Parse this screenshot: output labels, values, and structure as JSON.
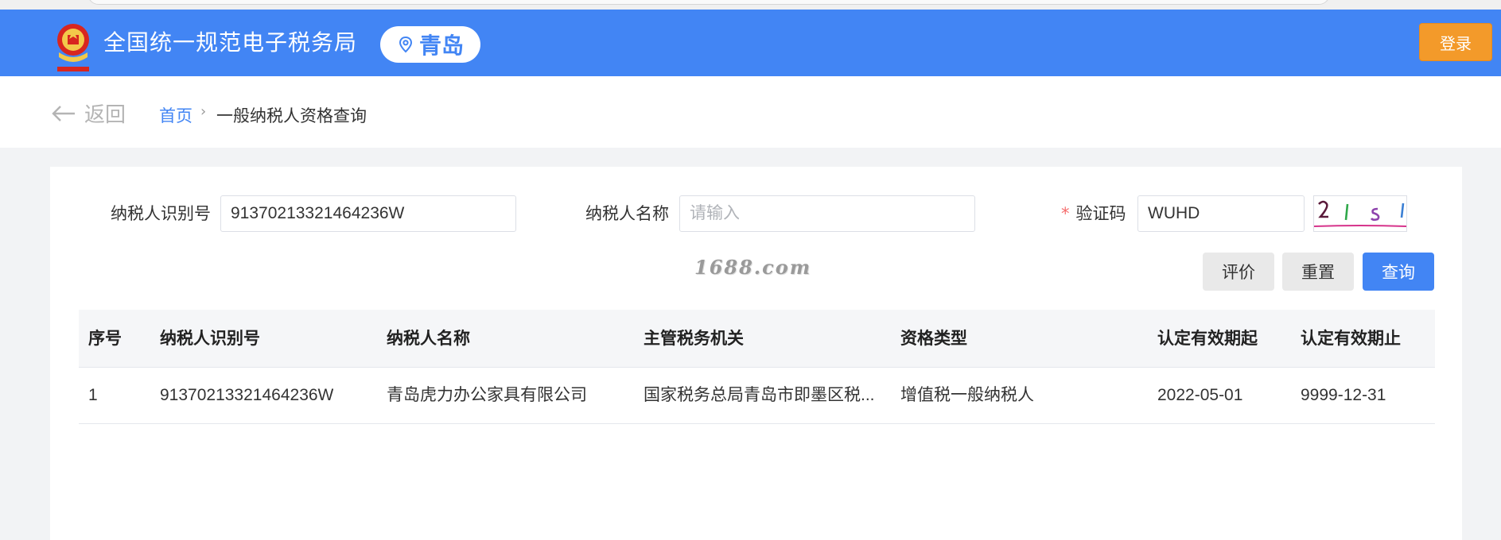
{
  "header": {
    "site_title": "全国统一规范电子税务局",
    "city": "青岛",
    "login_label": "登录",
    "brand_color": "#4285f4",
    "login_color": "#f39a2a"
  },
  "breadcrumb": {
    "back_label": "返回",
    "home_label": "首页",
    "separator": "›",
    "current_label": "一般纳税人资格查询"
  },
  "form": {
    "taxpayer_id_label": "纳税人识别号",
    "taxpayer_id_value": "91370213321464236W",
    "taxpayer_name_label": "纳税人名称",
    "taxpayer_name_placeholder": "请输入",
    "captcha_required_mark": "*",
    "captcha_label": "验证码",
    "captcha_value": "WUHD"
  },
  "watermark": "1688.com",
  "buttons": {
    "evaluate_label": "评价",
    "reset_label": "重置",
    "query_label": "查询"
  },
  "table": {
    "columns": [
      "序号",
      "纳税人识别号",
      "纳税人名称",
      "主管税务机关",
      "资格类型",
      "认定有效期起",
      "认定有效期止"
    ],
    "rows": [
      [
        "1",
        "91370213321464236W",
        "青岛虎力办公家具有限公司",
        "国家税务总局青岛市即墨区税...",
        "增值税一般纳税人",
        "2022-05-01",
        "9999-12-31"
      ]
    ]
  }
}
